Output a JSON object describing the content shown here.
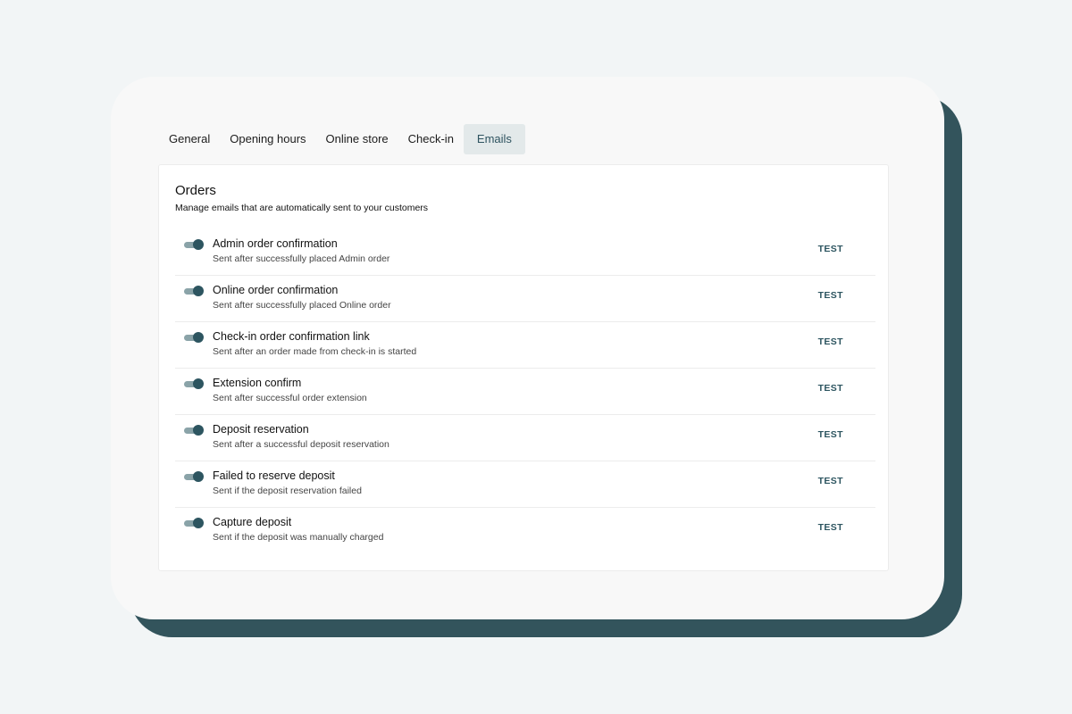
{
  "tabs": [
    {
      "label": "General",
      "active": false
    },
    {
      "label": "Opening hours",
      "active": false
    },
    {
      "label": "Online store",
      "active": false
    },
    {
      "label": "Check-in",
      "active": false
    },
    {
      "label": "Emails",
      "active": true
    }
  ],
  "panel": {
    "title": "Orders",
    "subtitle": "Manage emails that are automatically sent to your customers"
  },
  "emails": [
    {
      "title": "Admin order confirmation",
      "description": "Sent after successfully placed Admin order",
      "enabled": true,
      "action_label": "TEST"
    },
    {
      "title": "Online order confirmation",
      "description": "Sent after successfully placed Online order",
      "enabled": true,
      "action_label": "TEST"
    },
    {
      "title": "Check-in order confirmation link",
      "description": "Sent after an order made from check-in is started",
      "enabled": true,
      "action_label": "TEST"
    },
    {
      "title": "Extension confirm",
      "description": "Sent after successful order extension",
      "enabled": true,
      "action_label": "TEST"
    },
    {
      "title": "Deposit reservation",
      "description": "Sent after a successful deposit reservation",
      "enabled": true,
      "action_label": "TEST"
    },
    {
      "title": "Failed to reserve deposit",
      "description": "Sent if the deposit reservation failed",
      "enabled": true,
      "action_label": "TEST"
    },
    {
      "title": "Capture deposit",
      "description": "Sent if the deposit was manually charged",
      "enabled": true,
      "action_label": "TEST"
    }
  ],
  "colors": {
    "accent": "#2d5560",
    "card_shadow": "#33545c",
    "toggle_track": "#8aa3a8",
    "active_tab_bg": "#e3e9ea",
    "page_bg": "#f2f5f6"
  }
}
